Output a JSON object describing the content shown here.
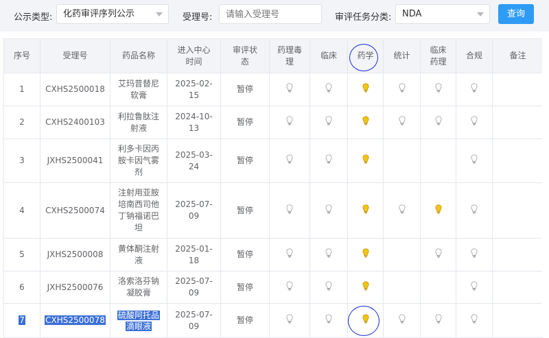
{
  "filters": {
    "type_label": "公示类型:",
    "type_value": "化药审评序列公示",
    "accept_label": "受理号:",
    "accept_placeholder": "请输入受理号",
    "task_label": "审评任务分类:",
    "task_value": "NDA",
    "query_button": "查询"
  },
  "table": {
    "headers": {
      "seq": "序号",
      "accept": "受理号",
      "name": "药品名称",
      "enter_line1": "进入中心",
      "enter_line2": "时间",
      "status_line1": "审评状",
      "status_line2": "态",
      "pharmtox_line1": "药理毒",
      "pharmtox_line2": "理",
      "clinical": "临床",
      "pharmacy": "药学",
      "stats": "统计",
      "clinpharm_line1": "临床",
      "clinpharm_line2": "药理",
      "compliance": "合规",
      "remarks": "备注"
    },
    "rows": [
      {
        "seq": "1",
        "accept": "CXHS2500018",
        "name": [
          "艾玛昔替尼",
          "软膏"
        ],
        "date": [
          "2025-02-",
          "15"
        ],
        "status": "暂停",
        "bulbs": {
          "pharmtox": "off",
          "clinical": "off",
          "pharmacy": "on",
          "stats": "off",
          "clinpharm": "off",
          "compliance": "off"
        }
      },
      {
        "seq": "2",
        "accept": "CXHS2400103",
        "name": [
          "利拉鲁肽注",
          "射液"
        ],
        "date": [
          "2024-10-",
          "13"
        ],
        "status": "暂停",
        "bulbs": {
          "pharmtox": "off",
          "clinical": "off",
          "pharmacy": "on",
          "stats": "off",
          "clinpharm": "off",
          "compliance": "off"
        }
      },
      {
        "seq": "3",
        "accept": "JXHS2500041",
        "name": [
          "利多卡因丙",
          "胺卡因气雾",
          "剂"
        ],
        "date": [
          "2025-03-",
          "24"
        ],
        "status": "暂停",
        "bulbs": {
          "pharmtox": "off",
          "clinical": "off",
          "pharmacy": "on",
          "stats": "none",
          "clinpharm": "none",
          "compliance": "off"
        }
      },
      {
        "seq": "4",
        "accept": "CXHS2500074",
        "name": [
          "注射用亚胺",
          "培南西司他",
          "丁钠福诺巴",
          "坦"
        ],
        "date": [
          "2025-07-",
          "09"
        ],
        "status": "暂停",
        "bulbs": {
          "pharmtox": "off",
          "clinical": "off",
          "pharmacy": "on",
          "stats": "off",
          "clinpharm": "on",
          "compliance": "off"
        }
      },
      {
        "seq": "5",
        "accept": "JXHS2500008",
        "name": [
          "黄体酮注射",
          "液"
        ],
        "date": [
          "2025-01-",
          "18"
        ],
        "status": "暂停",
        "bulbs": {
          "pharmtox": "off",
          "clinical": "off",
          "pharmacy": "on",
          "stats": "none",
          "clinpharm": "off",
          "compliance": "off"
        }
      },
      {
        "seq": "6",
        "accept": "JXHS2500076",
        "name": [
          "洛索洛芬钠",
          "凝胶膏"
        ],
        "date": [
          "2025-07-",
          "09"
        ],
        "status": "暂停",
        "bulbs": {
          "pharmtox": "off",
          "clinical": "off",
          "pharmacy": "on",
          "stats": "none",
          "clinpharm": "none",
          "compliance": "off"
        }
      },
      {
        "seq": "7",
        "accept": "CXHS2500078",
        "name": [
          "硫酸阿托品",
          "滴眼液"
        ],
        "date": [
          "2025-07-",
          "09"
        ],
        "status": "暂停",
        "bulbs": {
          "pharmtox": "off",
          "clinical": "off",
          "pharmacy": "on",
          "stats": "off",
          "clinpharm": "off",
          "compliance": "off"
        }
      }
    ]
  },
  "colors": {
    "accent": "#2e9cf5",
    "bulb_on": "#f0c419",
    "bulb_off": "#c8c8c8",
    "selection": "#3b6fd6",
    "annotation": "#1a2fd2"
  }
}
